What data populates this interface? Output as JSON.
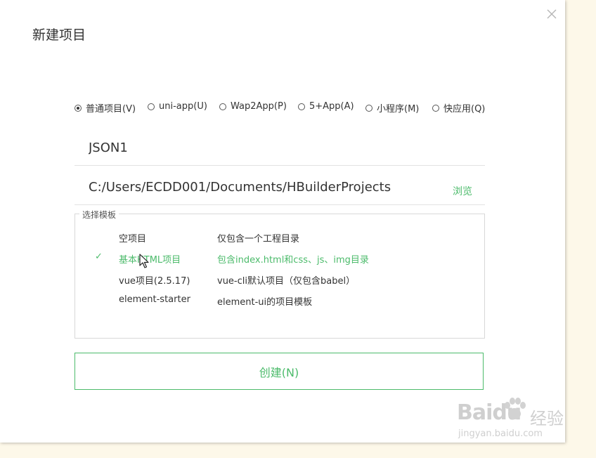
{
  "dialog": {
    "title": "新建项目",
    "close_icon": "close-icon"
  },
  "project_types": [
    {
      "label": "普通项目(V)",
      "selected": true
    },
    {
      "label": "uni-app(U)",
      "selected": false
    },
    {
      "label": "Wap2App(P)",
      "selected": false
    },
    {
      "label": "5+App(A)",
      "selected": false
    },
    {
      "label": "小程序(M)",
      "selected": false
    },
    {
      "label": "快应用(Q)",
      "selected": false
    }
  ],
  "project_name": {
    "value": "JSON1"
  },
  "project_path": {
    "value": "C:/Users/ECDD001/Documents/HBuilderProjects",
    "browse_label": "浏览"
  },
  "templates": {
    "legend": "选择模板",
    "items": [
      {
        "name": "空项目",
        "description": "仅包含一个工程目录",
        "selected": false
      },
      {
        "name": "基本HTML项目",
        "description": "包含index.html和css、js、img目录",
        "selected": true
      },
      {
        "name": "vue项目(2.5.17)",
        "description": "vue-cli默认项目（仅包含babel）",
        "selected": false
      },
      {
        "name": "element-starter",
        "description": "element-ui的项目模板",
        "selected": false
      }
    ],
    "check_glyph": "✓"
  },
  "create_button": {
    "label": "创建(N)"
  },
  "watermark": {
    "brand": "Baidu",
    "sub": "经验",
    "url": "jingyan.baidu.com"
  },
  "colors": {
    "accent": "#4cbb6b",
    "background": "#fdf8e9"
  }
}
